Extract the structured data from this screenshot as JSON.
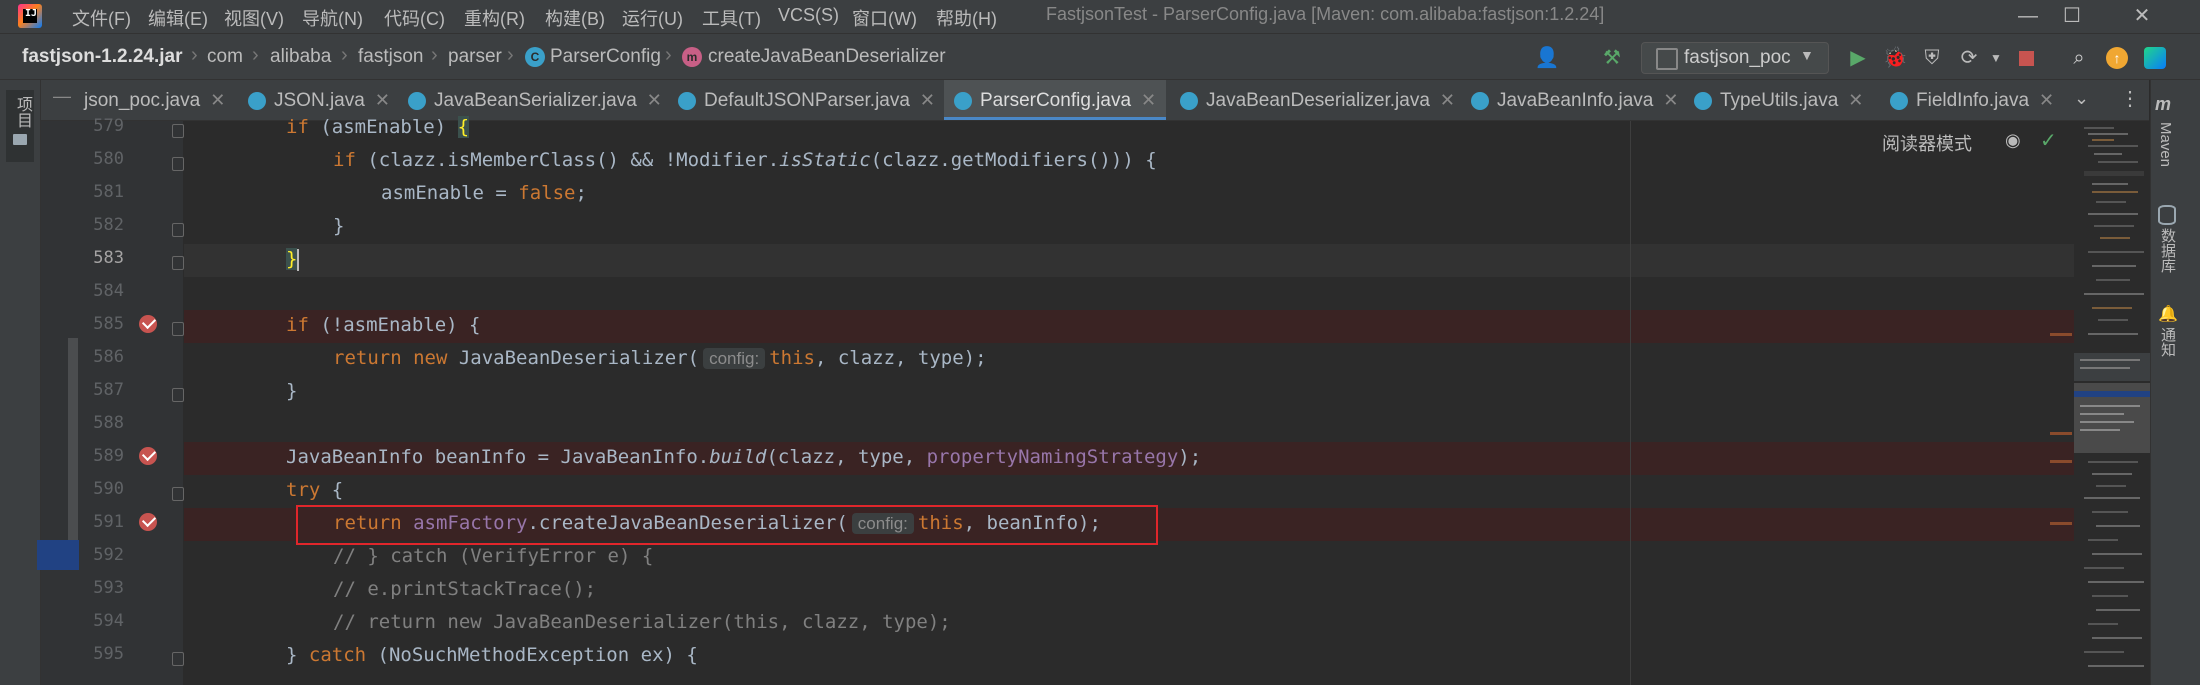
{
  "menu": [
    "文件(F)",
    "编辑(E)",
    "视图(V)",
    "导航(N)",
    "代码(C)",
    "重构(R)",
    "构建(B)",
    "运行(U)",
    "工具(T)",
    "VCS(S)",
    "窗口(W)",
    "帮助(H)"
  ],
  "window_title": "FastjsonTest - ParserConfig.java [Maven: com.alibaba:fastjson:1.2.24]",
  "window_controls": {
    "minimize": "—",
    "maximize": "☐",
    "close": "✕"
  },
  "breadcrumbs": [
    "fastjson-1.2.24.jar",
    "com",
    "alibaba",
    "fastjson",
    "parser",
    "ParserConfig",
    "createJavaBeanDeserializer"
  ],
  "run_config": "fastjson_poc",
  "left_tool": "项目",
  "right_tools": [
    "Maven",
    "数据库",
    "通知"
  ],
  "tabs": [
    {
      "label": "json_poc.java"
    },
    {
      "label": "JSON.java"
    },
    {
      "label": "JavaBeanSerializer.java"
    },
    {
      "label": "DefaultJSONParser.java"
    },
    {
      "label": "ParserConfig.java",
      "active": true
    },
    {
      "label": "JavaBeanDeserializer.java"
    },
    {
      "label": "JavaBeanInfo.java"
    },
    {
      "label": "TypeUtils.java"
    },
    {
      "label": "FieldInfo.java"
    }
  ],
  "reader_mode": "阅读器模式",
  "code": {
    "line_numbers": [
      "579",
      "580",
      "581",
      "582",
      "583",
      "584",
      "585",
      "586",
      "587",
      "588",
      "589",
      "590",
      "591",
      "592",
      "593",
      "594",
      "595"
    ],
    "l579": {
      "kw": "if",
      "rest": " (asmEnable) ",
      "brace": "{"
    },
    "l580": {
      "kw": "if",
      "a": " (clazz.isMemberClass() && !Modifier.",
      "m": "isStatic",
      "b": "(clazz.getModifiers())) {"
    },
    "l581": {
      "a": "asmEnable = ",
      "kw": "false",
      "b": ";"
    },
    "l582": "}",
    "l583": "}",
    "l585": {
      "kw": "if",
      "rest": " (!asmEnable) {"
    },
    "l586": {
      "kw1": "return",
      "kw2": "new",
      "a": " JavaBeanDeserializer(",
      "hint": "config:",
      "kw3": "this",
      "b": ", clazz, type);"
    },
    "l587": "}",
    "l589": {
      "a": "JavaBeanInfo beanInfo = JavaBeanInfo.",
      "m": "build",
      "b": "(clazz, type, ",
      "f": "propertyNamingStrategy",
      "c": ");"
    },
    "l590": {
      "kw": "try",
      "rest": " {"
    },
    "l591": {
      "kw1": "return",
      "f": "asmFactory",
      "a": ".createJavaBeanDeserializer(",
      "hint": "config:",
      "kw2": "this",
      "b": ", beanInfo);"
    },
    "l592": "// } catch (VerifyError e) {",
    "l593": "// e.printStackTrace();",
    "l594": "// return new JavaBeanDeserializer(this, clazz, type);",
    "l595": {
      "a": "} ",
      "kw": "catch",
      "b": " (NoSuchMethodException ex) {"
    }
  }
}
